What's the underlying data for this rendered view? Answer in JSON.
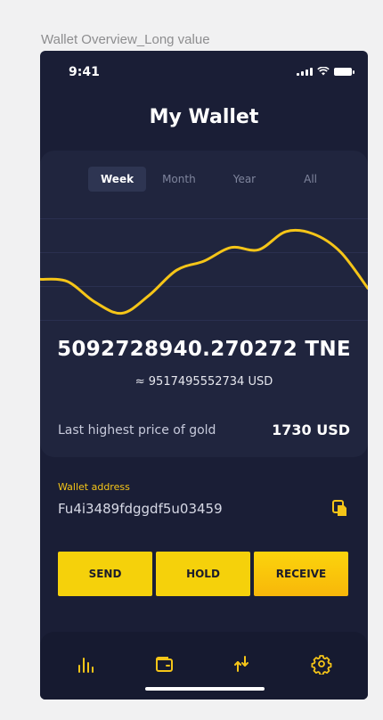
{
  "frame": {
    "label": "Wallet Overview_Long value"
  },
  "status_bar": {
    "time": "9:41"
  },
  "header": {
    "title": "My Wallet"
  },
  "tabs": [
    {
      "label": "Week",
      "active": true
    },
    {
      "label": "Month",
      "active": false
    },
    {
      "label": "Year",
      "active": false
    },
    {
      "label": "All",
      "active": false
    }
  ],
  "chart_data": {
    "type": "line",
    "x": [
      0,
      1,
      2,
      3,
      4,
      5,
      6,
      7,
      8,
      9,
      10,
      11,
      12
    ],
    "series": [
      {
        "values": [
          50,
          48,
          30,
          20,
          36,
          58,
          66,
          78,
          76,
          92,
          90,
          74,
          42
        ]
      }
    ],
    "ylim": [
      0,
      110
    ],
    "grid": true,
    "line_color": "#f5c518"
  },
  "balance": {
    "amount": "5092728940.270272 TNE",
    "usd": "≈ 9517495552734 USD"
  },
  "price": {
    "label": "Last highest price of gold",
    "value": "1730 USD"
  },
  "wallet": {
    "label": "Wallet address",
    "address": "Fu4i3489fdggdf5u03459"
  },
  "actions": {
    "send": "SEND",
    "hold": "HOLD",
    "receive": "RECEIVE"
  },
  "nav": {
    "icons": [
      "chart-icon",
      "wallet-icon",
      "transfer-icon",
      "settings-icon"
    ]
  },
  "colors": {
    "accent": "#f5c518",
    "background": "#1a1e36",
    "card": "#20253e"
  }
}
